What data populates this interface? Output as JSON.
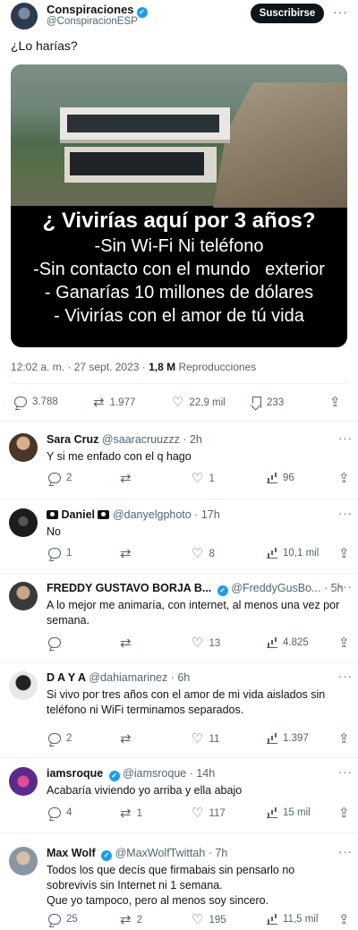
{
  "author": {
    "name": "Conspiraciones",
    "handle": "@ConspiracionESP",
    "subscribe_label": "Suscribirse",
    "more": "···"
  },
  "tweet": {
    "text": "¿Lo harías?",
    "image_overlay": {
      "title": "¿ Vivirías aquí por 3 años?",
      "lines": [
        "-Sin Wi-Fi Ni teléfono",
        "-Sin contacto con el mundo   exterior",
        "- Ganarías 10 millones de dólares",
        "- Vivirías con el amor de tú vida"
      ]
    },
    "timestamp": "12:02 a. m. · 27 sept. 2023 ·",
    "views_count": "1,8 M",
    "views_label": "Reproducciones",
    "stats": {
      "replies": "3.788",
      "retweets": "1.977",
      "likes": "22,9 mil",
      "bookmarks": "233"
    }
  },
  "replies": [
    {
      "name": "Sara Cruz",
      "handle": "@saaracruuzzz · 2h",
      "text": "Y si me enfado con el q hago",
      "stats": {
        "replies": "2",
        "retweets": "",
        "likes": "1",
        "views": "96"
      }
    },
    {
      "name": "Daniel",
      "handle": "@danyelgphoto · 17h",
      "text": "No",
      "stats": {
        "replies": "1",
        "retweets": "",
        "likes": "8",
        "views": "10,1 mil"
      }
    },
    {
      "name": "FREDDY GUSTAVO BORJA B...",
      "handle": "@FreddyGusBo... · 5h",
      "text": "A lo mejor me animaría, con internet, al menos una vez por semana.",
      "stats": {
        "replies": "",
        "retweets": "",
        "likes": "13",
        "views": "4.825"
      }
    },
    {
      "name": "D A Y A",
      "handle": "@dahiamarinez · 6h",
      "text": "Si vivo por tres años con el amor de mi vida aislados sin teléfono ni WiFi terminamos separados.",
      "stats": {
        "replies": "2",
        "retweets": "",
        "likes": "11",
        "views": "1.397"
      }
    },
    {
      "name": "iamsroque",
      "handle": "@iamsroque · 14h",
      "text": "Acabaría viviendo yo arriba y ella abajo",
      "stats": {
        "replies": "4",
        "retweets": "1",
        "likes": "117",
        "views": "15 mil"
      }
    },
    {
      "name": "Max Wolf",
      "handle": "@MaxWolfTwittah · 7h",
      "text": "Todos los que decís que firmabais sin pensarlo no sobrevivís sin Internet ni 1 semana.\nQue yo tampoco, pero al menos soy sincero.",
      "stats": {
        "replies": "25",
        "retweets": "2",
        "likes": "195",
        "views": "11,5 mil"
      }
    }
  ],
  "colors": {
    "accent": "#1d9bf0",
    "text": "#0f1419",
    "muted": "#536471"
  },
  "icons": [
    "reply-icon",
    "retweet-icon",
    "like-icon",
    "views-icon",
    "bookmark-icon",
    "share-icon",
    "verified-icon",
    "camera-icon",
    "more-icon"
  ]
}
